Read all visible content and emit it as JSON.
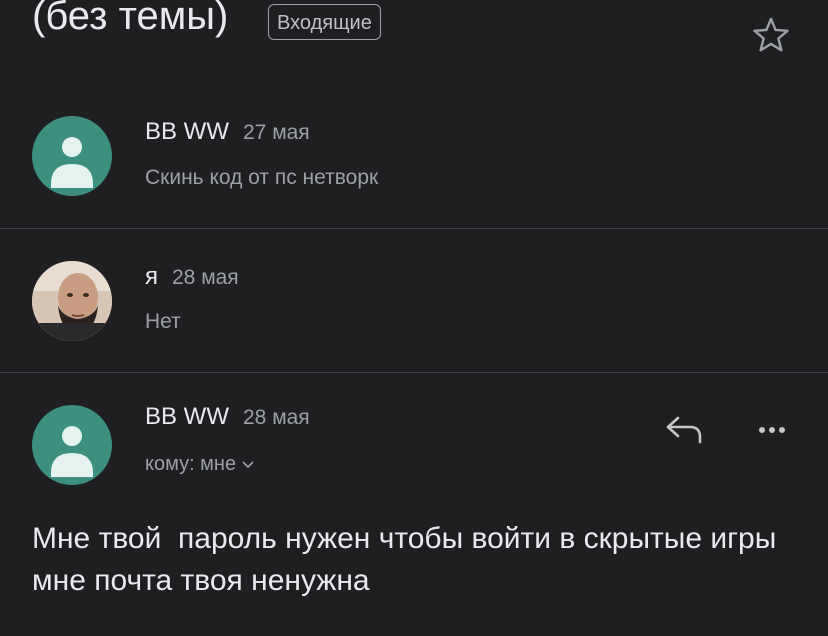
{
  "header": {
    "subject": "(без темы)",
    "label": "Входящие",
    "star_icon": "star-outline-icon"
  },
  "messages": [
    {
      "sender": "BB WW",
      "date": "27 мая",
      "snippet": "Скинь код от пс нетворк",
      "avatar": "generic-person-avatar",
      "avatar_color": "#3d8f7f"
    },
    {
      "sender": "я",
      "date": "28 мая",
      "snippet": "Нет",
      "avatar": "photo-avatar"
    },
    {
      "sender": "BB WW",
      "date": "28 мая",
      "recipient": "кому: мне",
      "avatar": "generic-person-avatar",
      "avatar_color": "#3d8f7f",
      "body": "Мне твой  пароль нужен чтобы войти в скрытые игры мне почта твоя ненужна",
      "actions": [
        "reply-icon",
        "more-options-icon"
      ]
    }
  ],
  "colors": {
    "background": "#1f1f21",
    "text_primary": "#e8eaed",
    "text_secondary": "#9aa0a6",
    "avatar_teal": "#3d8f7f",
    "divider": "#3c4043"
  }
}
